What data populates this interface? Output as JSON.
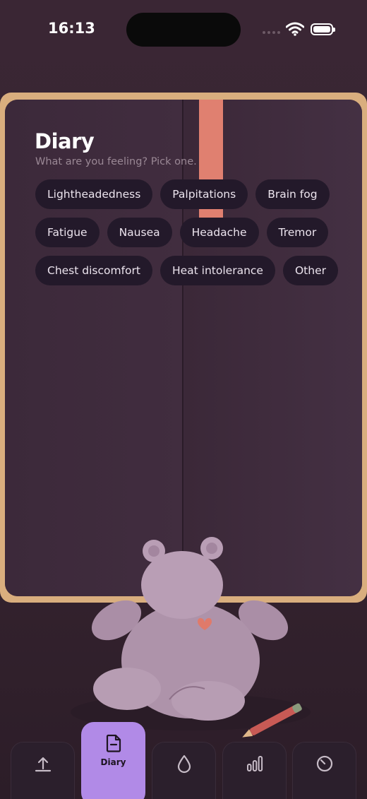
{
  "status": {
    "time": "16:13"
  },
  "diary": {
    "title": "Diary",
    "subtitle": "What are you feeling? Pick one.",
    "chips": [
      [
        "Lightheadedness",
        "Palpitations",
        "Brain fog"
      ],
      [
        "Fatigue",
        "Nausea",
        "Headache",
        "Tremor"
      ],
      [
        "Chest discomfort",
        "Heat intolerance",
        "Other"
      ]
    ]
  },
  "tabs": [
    {
      "icon": "upload-icon",
      "label": ""
    },
    {
      "icon": "document-icon",
      "label": "Diary",
      "active": true
    },
    {
      "icon": "drop-icon",
      "label": ""
    },
    {
      "icon": "bar-chart-icon",
      "label": ""
    },
    {
      "icon": "timer-icon",
      "label": ""
    }
  ],
  "colors": {
    "background": "#362430",
    "book_frame": "#d9ae7e",
    "ribbon": "#e08070",
    "chip": "#23192a",
    "active_tab": "#b18ae7"
  }
}
